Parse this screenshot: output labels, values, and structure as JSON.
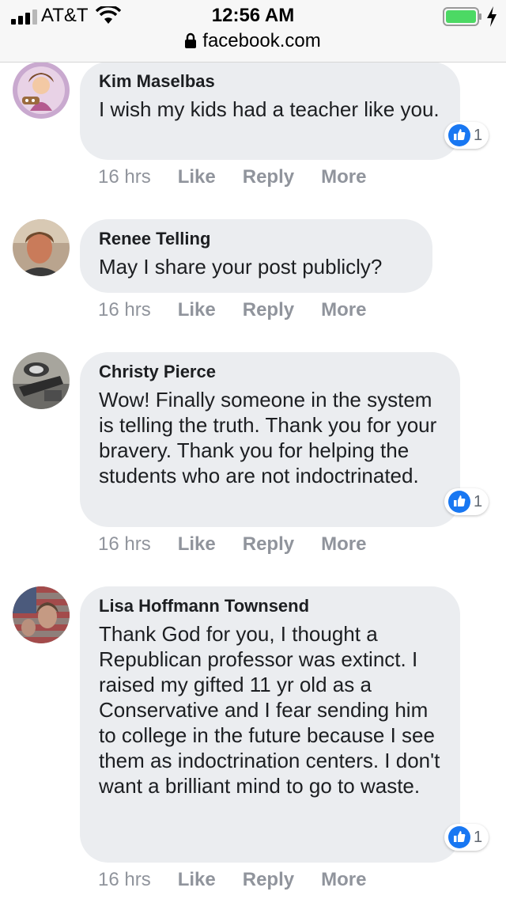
{
  "status_bar": {
    "carrier": "AT&T",
    "time": "12:56 AM",
    "battery_level": 1.0
  },
  "url_bar": {
    "url": "facebook.com"
  },
  "actions_labels": {
    "like": "Like",
    "reply": "Reply",
    "more": "More"
  },
  "comments": [
    {
      "author": "Kim Maselbas",
      "text": "I wish my kids had a teacher like you.",
      "time": "16 hrs",
      "reaction_count": "1"
    },
    {
      "author": "Renee Telling",
      "text": "May I share your post publicly?",
      "time": "16 hrs"
    },
    {
      "author": "Christy Pierce",
      "text": "Wow! Finally someone in the system is telling the truth. Thank you for your bravery. Thank you for helping the students who are not indoctrinated.",
      "time": "16 hrs",
      "reaction_count": "1"
    },
    {
      "author": "Lisa Hoffmann Townsend",
      "text": "Thank God for you, I thought a Republican professor was extinct. I raised my gifted 11 yr old as a Conservative and I fear sending him to college in the future because I see them as indoctrination centers. I don't want a brilliant mind to go to waste.",
      "time": "16 hrs",
      "reaction_count": "1"
    }
  ],
  "colors": {
    "bubble": "#ebedf0",
    "like_blue": "#1877f2",
    "meta_grey": "#90949c",
    "battery_green": "#4cd964"
  }
}
